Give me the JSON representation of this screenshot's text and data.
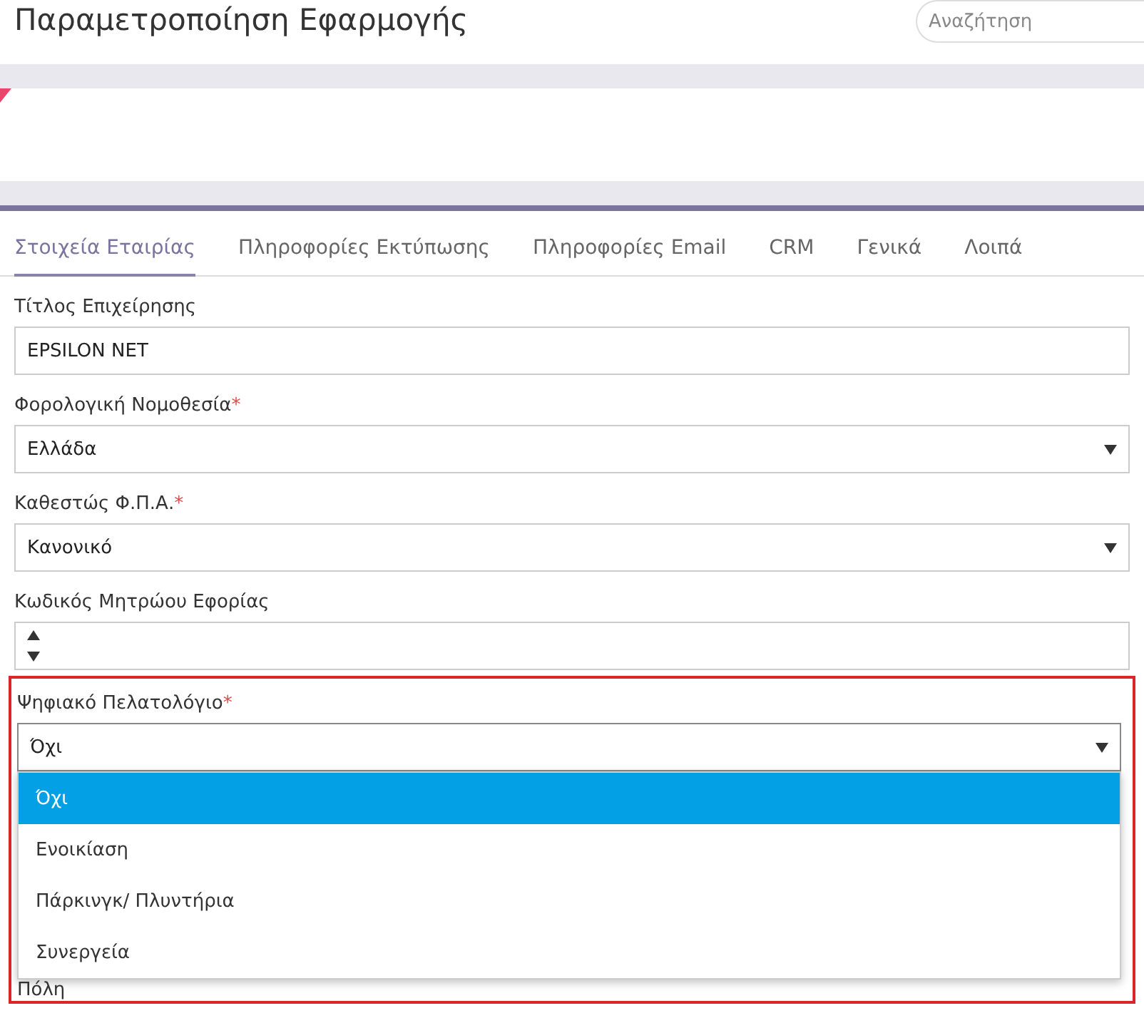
{
  "header": {
    "title": "Παραμετροποίηση Εφαρμογής",
    "search": {
      "placeholder": "Αναζήτηση"
    }
  },
  "tabs": [
    {
      "label": "Στοιχεία Εταιρίας",
      "selected": true
    },
    {
      "label": "Πληροφορίες Εκτύπωσης",
      "selected": false
    },
    {
      "label": "Πληροφορίες Email",
      "selected": false
    },
    {
      "label": "CRM",
      "selected": false
    },
    {
      "label": "Γενικά",
      "selected": false
    },
    {
      "label": "Λοιπά",
      "selected": false
    }
  ],
  "fields": [
    {
      "kind": "text",
      "label": "Τίτλος Επιχείρησης",
      "value": "EPSILON NET"
    },
    {
      "kind": "select",
      "label": "Φορολογική Νομοθεσία",
      "required_mark": "*",
      "value": "Ελλάδα"
    },
    {
      "kind": "select",
      "label": "Καθεστώς Φ.Π.Α.",
      "required_mark": "*",
      "value": "Κανονικό"
    },
    {
      "kind": "number",
      "label": "Κωδικός Μητρώου Εφορίας"
    }
  ],
  "highlighted_field": {
    "label": "Ψηφιακό Πελατολόγιο",
    "required_mark": "*",
    "value": "Όχι",
    "options": [
      {
        "label": "Όχι",
        "selected": true
      },
      {
        "label": "Ενοικίαση",
        "selected": false
      },
      {
        "label": "Πάρκινγκ/ Πλυντήρια",
        "selected": false
      },
      {
        "label": "Συνεργεία",
        "selected": false
      }
    ]
  },
  "next_field_label": "Πόλη"
}
